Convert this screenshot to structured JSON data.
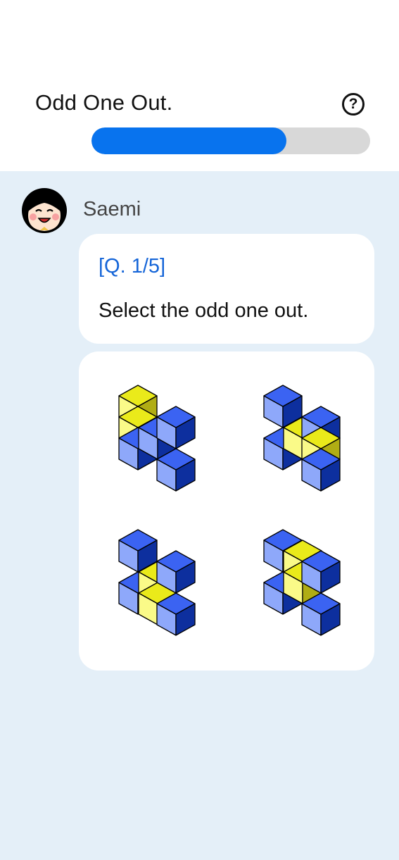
{
  "header": {
    "title": "Odd One Out.",
    "help_icon": "question-circle-icon",
    "help_glyph": "?",
    "progress": 0.7
  },
  "chat": {
    "sender": "Saemi",
    "avatar": "smiling-girl-avatar",
    "question_number": "[Q. 1/5]",
    "prompt": "Select the odd one out.",
    "options": [
      {
        "name": "option-1",
        "figure": "isometric-cube-figure"
      },
      {
        "name": "option-2",
        "figure": "isometric-cube-figure"
      },
      {
        "name": "option-3",
        "figure": "isometric-cube-figure"
      },
      {
        "name": "option-4",
        "figure": "isometric-cube-figure"
      }
    ]
  },
  "colors": {
    "accent": "#0873ee",
    "background": "#e4eff8",
    "cube_blue_top": "#3b63f2",
    "cube_blue_left": "#8ea8fa",
    "cube_blue_right": "#0d2f9e",
    "cube_yellow_top": "#eaea1a",
    "cube_yellow_left": "#fafa88",
    "cube_yellow_right": "#b0ad14"
  }
}
